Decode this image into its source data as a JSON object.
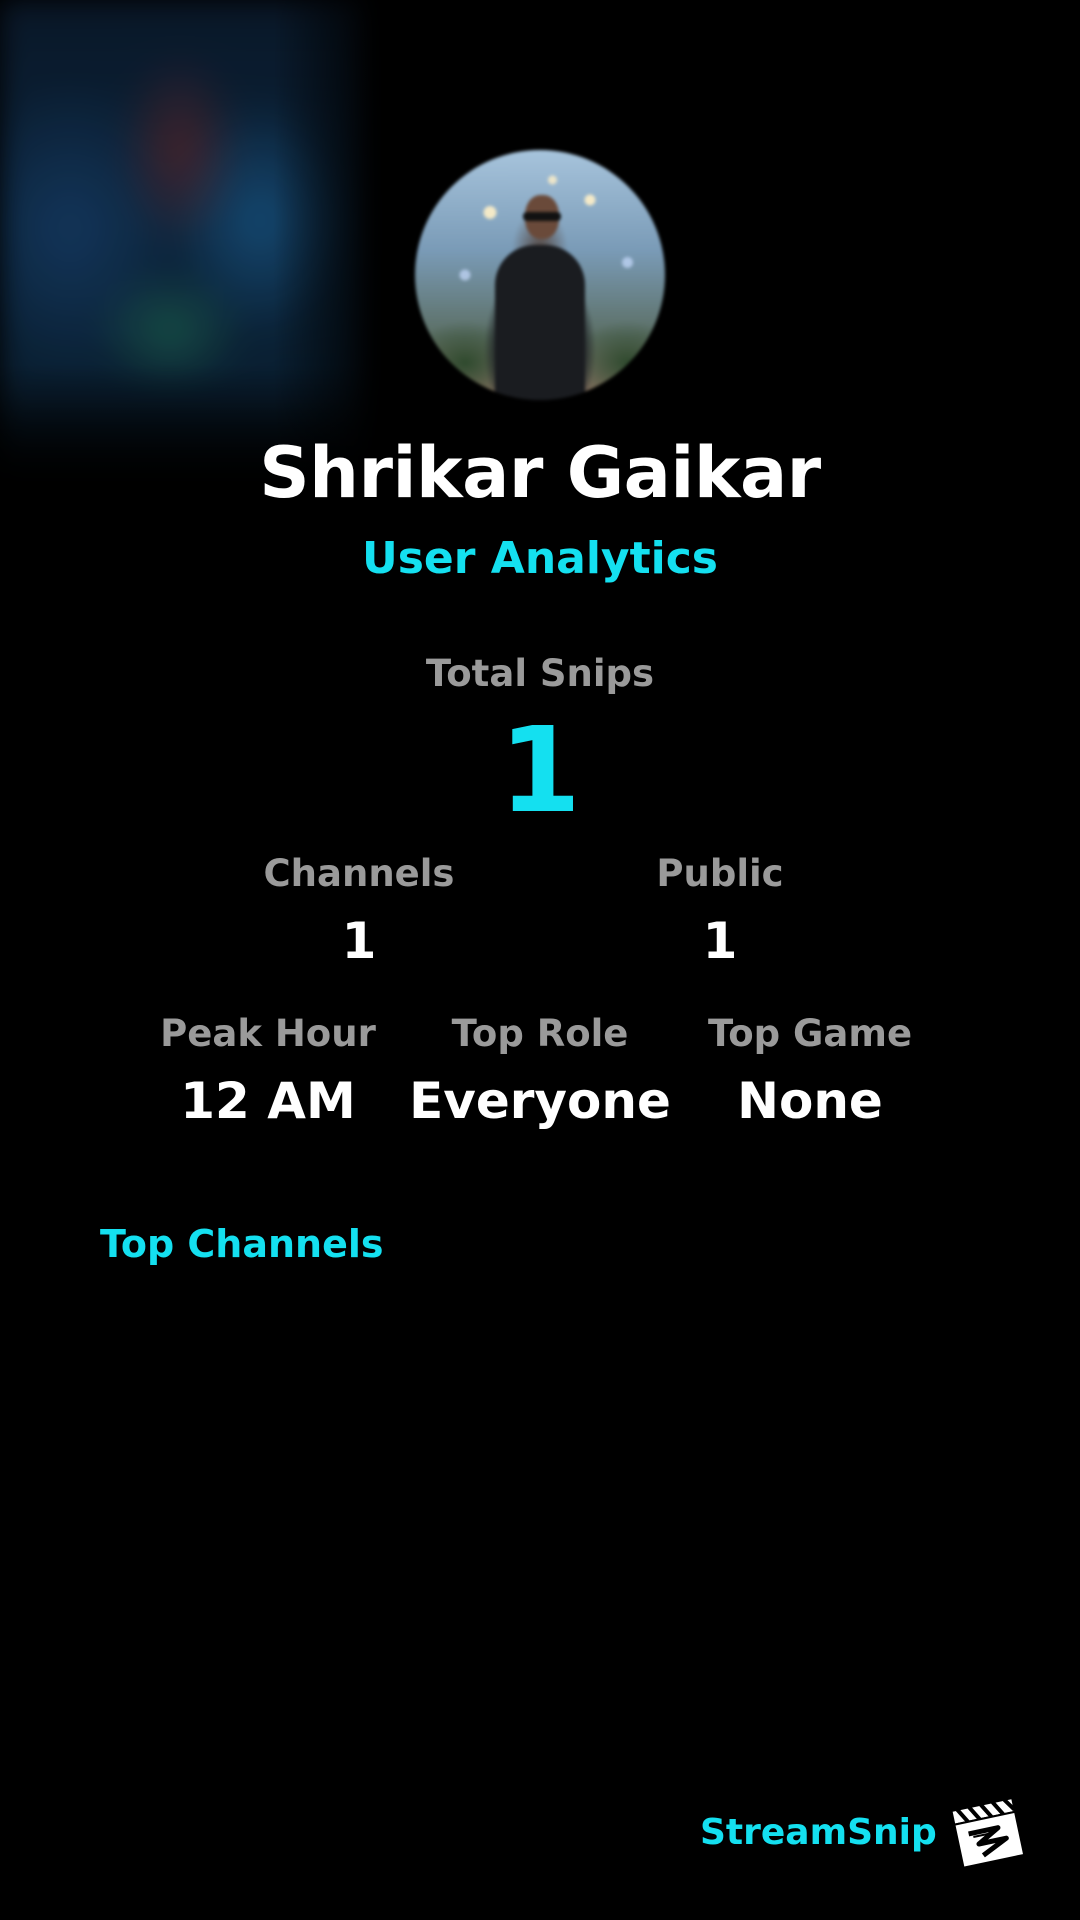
{
  "profile": {
    "name": "Shrikar Gaikar",
    "subtitle": "User Analytics",
    "avatar": "user-avatar-photo"
  },
  "stats": {
    "total_snips": {
      "label": "Total Snips",
      "value": "1"
    },
    "channels": {
      "label": "Channels",
      "value": "1"
    },
    "public": {
      "label": "Public",
      "value": "1"
    },
    "peak_hour": {
      "label": "Peak Hour",
      "value": "12 AM"
    },
    "top_role": {
      "label": "Top Role",
      "value": "Everyone"
    },
    "top_game": {
      "label": "Top Game",
      "value": "None"
    }
  },
  "sections": {
    "top_channels_title": "Top Channels"
  },
  "footer": {
    "brand_name": "StreamSnip",
    "brand_icon": "clapperboard-logo-icon"
  },
  "colors": {
    "background": "#000000",
    "accent": "#14e0f0",
    "label": "#9a9a9a",
    "text": "#ffffff"
  }
}
